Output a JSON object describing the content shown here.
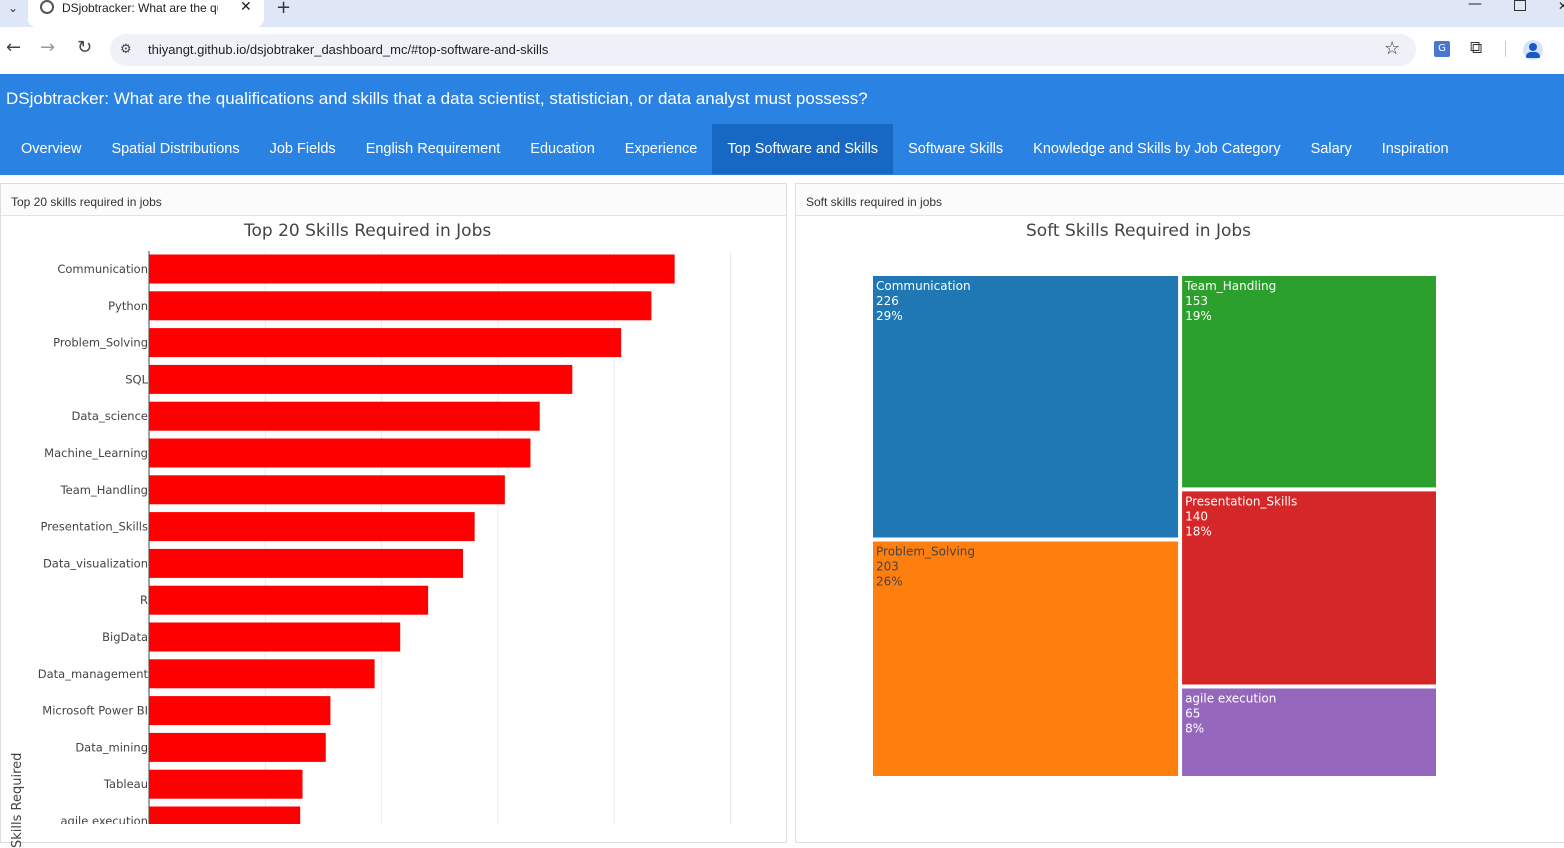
{
  "browser": {
    "tab_title": "DSjobtracker: What are the qu",
    "url": "thiyangt.github.io/dsjobtraker_dashboard_mc/#top-software-and-skills"
  },
  "dashboard": {
    "title": "DSjobtracker: What are the qualifications and skills that a data scientist, statistician, or data analyst must possess?",
    "nav": [
      {
        "label": "Overview"
      },
      {
        "label": "Spatial Distributions"
      },
      {
        "label": "Job Fields"
      },
      {
        "label": "English Requirement"
      },
      {
        "label": "Education"
      },
      {
        "label": "Experience"
      },
      {
        "label": "Top Software and Skills",
        "active": true
      },
      {
        "label": "Software Skills"
      },
      {
        "label": "Knowledge and Skills by Job Category"
      },
      {
        "label": "Salary"
      },
      {
        "label": "Inspiration"
      }
    ]
  },
  "panels": {
    "skills": {
      "header": "Top 20 skills required in jobs"
    },
    "soft": {
      "header": "Soft skills required in jobs"
    }
  },
  "chart_data": [
    {
      "type": "bar",
      "orientation": "horizontal",
      "title": "Top 20 Skills Required in Jobs",
      "ylabel": "Skills Required",
      "color": "#ff0000",
      "grid": true,
      "xlim": [
        0,
        270
      ],
      "categories": [
        "Communication",
        "Python",
        "Problem_Solving",
        "SQL",
        "Data_science",
        "Machine_Learning",
        "Team_Handling",
        "Presentation_Skills",
        "Data_visualization",
        "R",
        "BigData",
        "Data_management",
        "Microsoft Power BI",
        "Data_mining",
        "Tableau",
        "agile execution"
      ],
      "values": [
        226,
        216,
        203,
        182,
        168,
        164,
        153,
        140,
        135,
        120,
        108,
        97,
        78,
        76,
        66,
        65
      ]
    },
    {
      "type": "treemap",
      "title": "Soft Skills Required in Jobs",
      "items": [
        {
          "label": "Communication",
          "value": 226,
          "percent": "29%",
          "color": "#1f77b4"
        },
        {
          "label": "Problem_Solving",
          "value": 203,
          "percent": "26%",
          "color": "#ff7f0e"
        },
        {
          "label": "Team_Handling",
          "value": 153,
          "percent": "19%",
          "color": "#2ca02c"
        },
        {
          "label": "Presentation_Skills",
          "value": 140,
          "percent": "18%",
          "color": "#d62728"
        },
        {
          "label": "agile execution",
          "value": 65,
          "percent": "8%",
          "color": "#9467bd"
        }
      ]
    }
  ]
}
